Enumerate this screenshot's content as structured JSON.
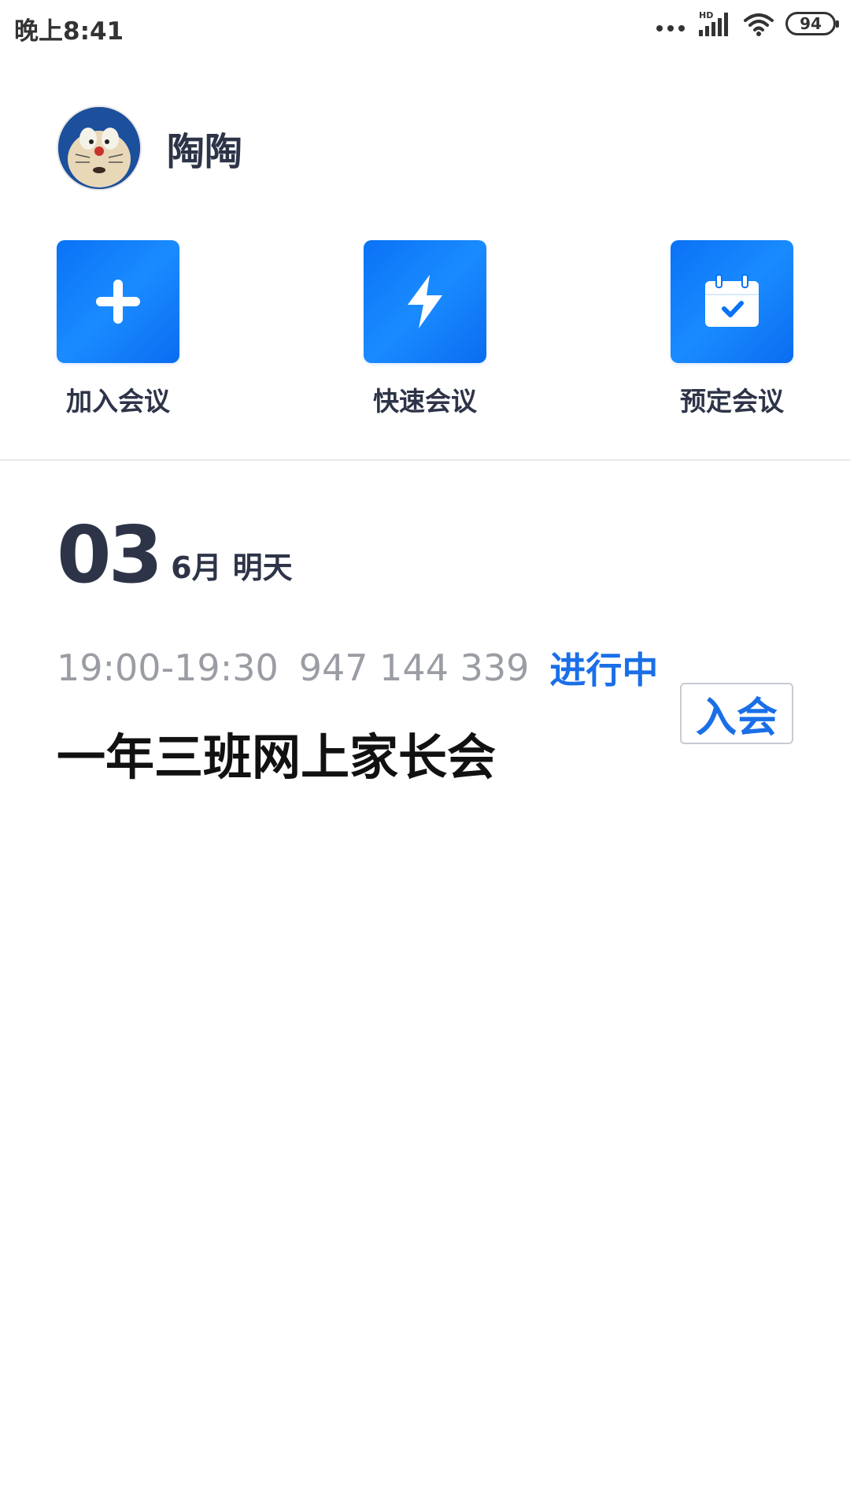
{
  "status_bar": {
    "time": "晚上8:41",
    "network_label": "HD",
    "battery": "94",
    "icons": [
      "more-dots-icon",
      "signal-icon",
      "wifi-icon",
      "battery-icon"
    ]
  },
  "profile": {
    "name": "陶陶",
    "avatar_icon": "doraemon-avatar"
  },
  "actions": [
    {
      "label": "加入会议",
      "icon": "plus-icon"
    },
    {
      "label": "快速会议",
      "icon": "lightning-icon"
    },
    {
      "label": "预定会议",
      "icon": "calendar-check-icon"
    }
  ],
  "date": {
    "day": "03",
    "month": "6月",
    "relative": "明天"
  },
  "meeting": {
    "time": "19:00-19:30",
    "id": "947 144 339",
    "status": "进行中",
    "title": "一年三班网上家长会",
    "join_label": "入会"
  },
  "colors": {
    "accent": "#1a6fe8",
    "tile": "#0a72f5",
    "text": "#2e3448",
    "muted": "#9a9da3"
  }
}
